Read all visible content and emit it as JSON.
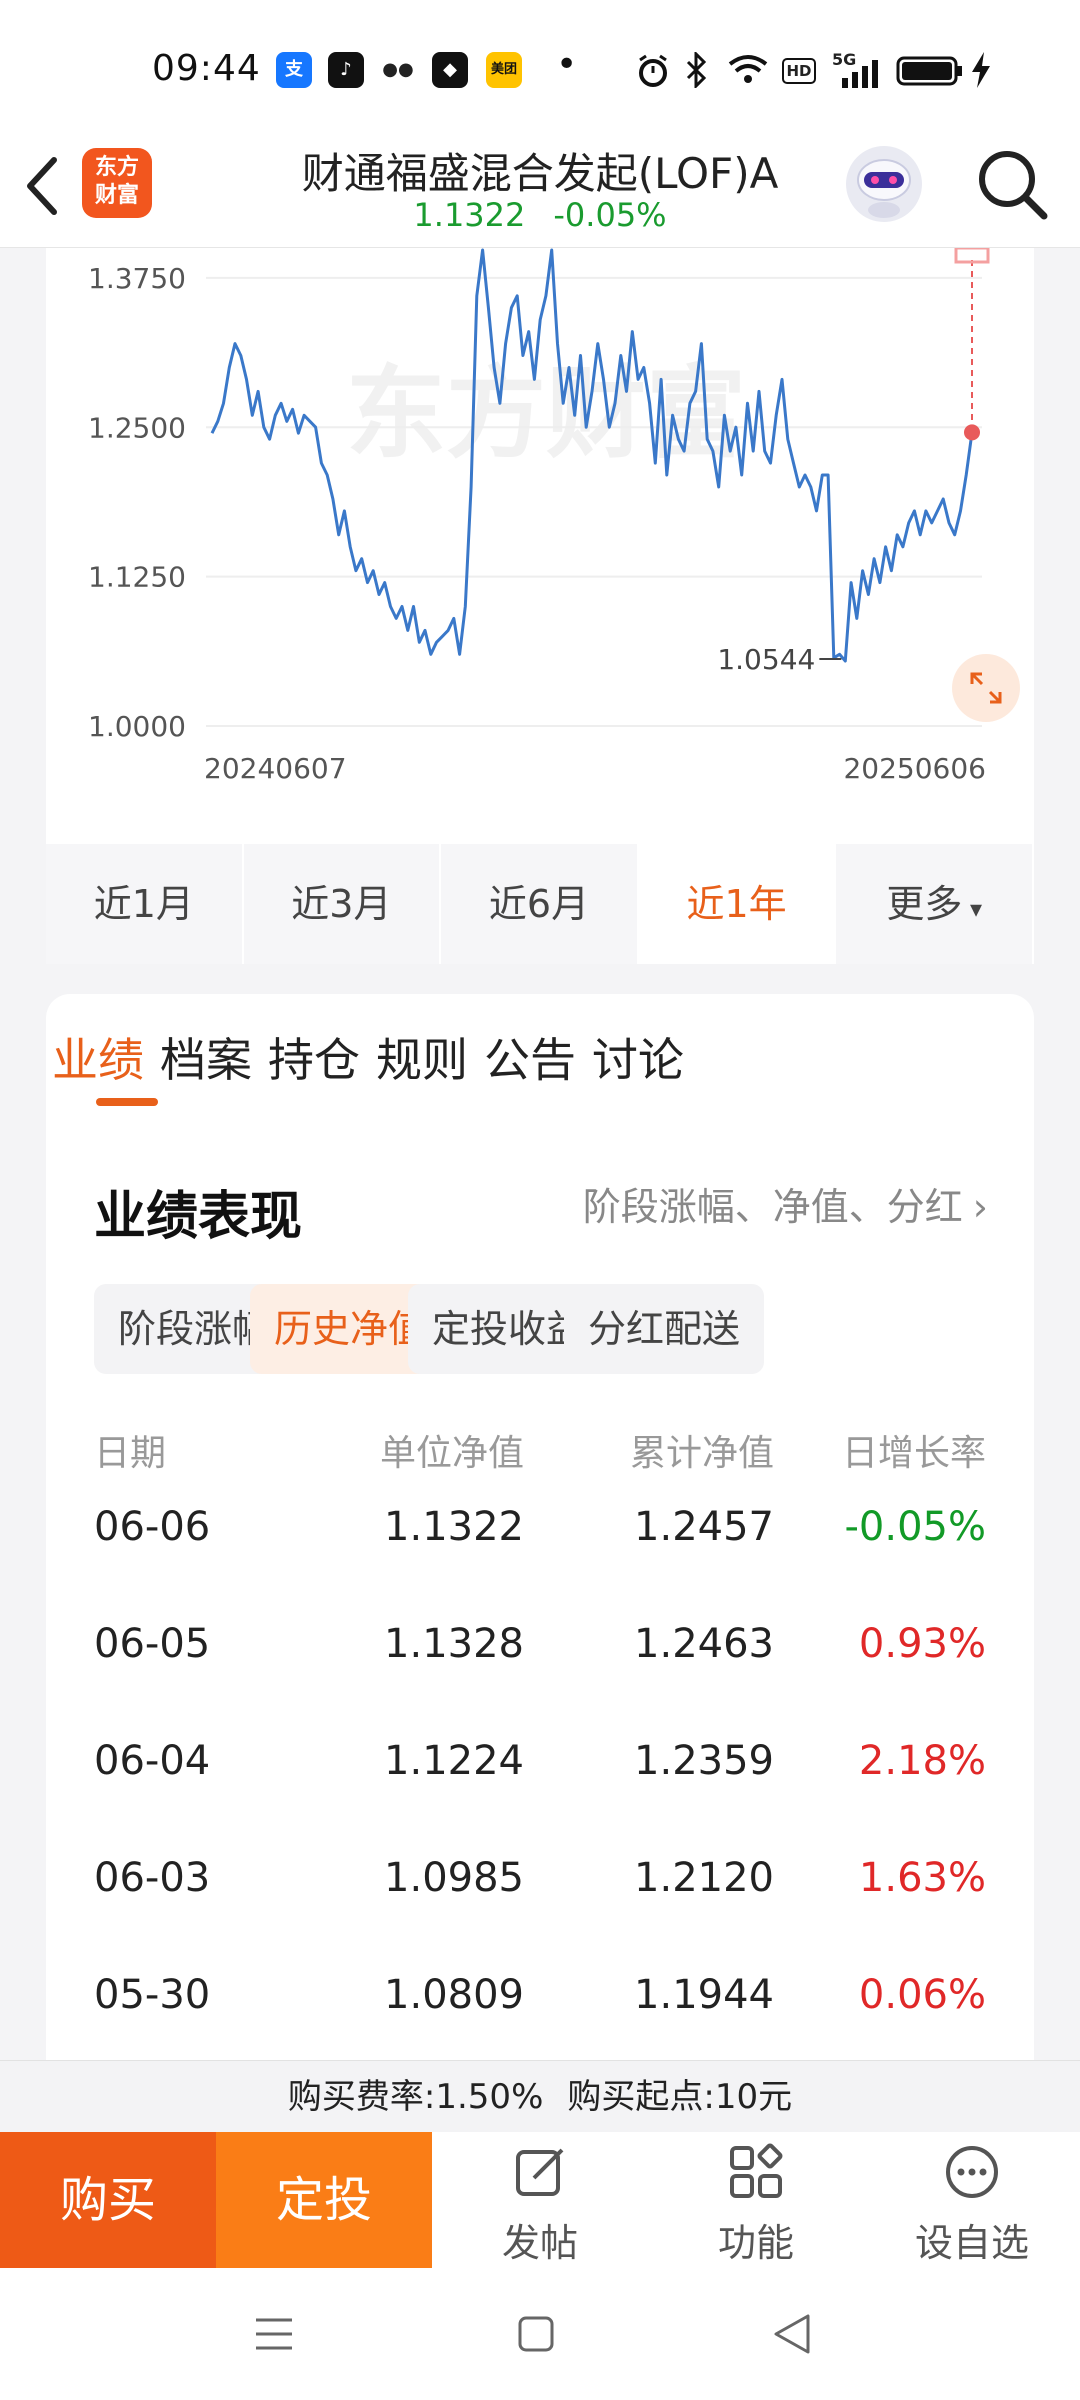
{
  "status": {
    "time": "09:44",
    "apps": [
      {
        "name": "alipay-icon",
        "glyph": "支",
        "color": "#1677ff"
      },
      {
        "name": "douyin-icon",
        "glyph": "♪",
        "color": "#111111"
      },
      {
        "name": "wechat-icon",
        "glyph": "●●",
        "color": "#222222"
      },
      {
        "name": "app-icon",
        "glyph": "◆",
        "color": "#111111"
      },
      {
        "name": "meituan-icon",
        "glyph": "美团",
        "color": "#ffc300"
      }
    ],
    "dot": "•",
    "hd": "HD",
    "net": "5G"
  },
  "header": {
    "logo_line1": "东方",
    "logo_line2": "财富",
    "title": "财通福盛混合发起(LOF)A",
    "nav": "1.1322",
    "change": "-0.05%"
  },
  "chart_data": {
    "type": "line",
    "y_ticks": [
      "1.3750",
      "1.2500",
      "1.1250",
      "1.0000"
    ],
    "ylim": [
      1.0,
      1.4
    ],
    "x_labels": [
      "20240607",
      "20250606"
    ],
    "min_label": "1.0544",
    "watermark": "东方财富",
    "series": [
      {
        "values": [
          1.245,
          1.255,
          1.27,
          1.3,
          1.32,
          1.31,
          1.29,
          1.26,
          1.28,
          1.25,
          1.24,
          1.26,
          1.27,
          1.255,
          1.265,
          1.245,
          1.26,
          1.255,
          1.25,
          1.22,
          1.21,
          1.19,
          1.16,
          1.18,
          1.15,
          1.13,
          1.14,
          1.12,
          1.13,
          1.11,
          1.12,
          1.1,
          1.09,
          1.1,
          1.08,
          1.1,
          1.07,
          1.08,
          1.06,
          1.07,
          1.075,
          1.08,
          1.09,
          1.06,
          1.1,
          1.2,
          1.36,
          1.42,
          1.35,
          1.3,
          1.27,
          1.32,
          1.35,
          1.36,
          1.31,
          1.33,
          1.29,
          1.34,
          1.36,
          1.4,
          1.32,
          1.27,
          1.3,
          1.26,
          1.31,
          1.25,
          1.28,
          1.32,
          1.29,
          1.25,
          1.27,
          1.31,
          1.28,
          1.33,
          1.29,
          1.3,
          1.27,
          1.22,
          1.29,
          1.21,
          1.26,
          1.24,
          1.23,
          1.27,
          1.28,
          1.32,
          1.24,
          1.23,
          1.2,
          1.26,
          1.23,
          1.25,
          1.21,
          1.27,
          1.23,
          1.28,
          1.23,
          1.22,
          1.26,
          1.29,
          1.24,
          1.22,
          1.2,
          1.21,
          1.2,
          1.18,
          1.21,
          1.21,
          1.057,
          1.06,
          1.0544,
          1.12,
          1.09,
          1.13,
          1.11,
          1.14,
          1.12,
          1.15,
          1.13,
          1.16,
          1.15,
          1.17,
          1.18,
          1.16,
          1.18,
          1.17,
          1.18,
          1.19,
          1.17,
          1.16,
          1.18,
          1.21,
          1.2457
        ]
      }
    ],
    "marker_color": "#e85a5a",
    "line_color": "#3a78c9"
  },
  "periods": [
    "近1月",
    "近3月",
    "近6月",
    "近1年",
    "更多"
  ],
  "periods_active": 3,
  "tabs": [
    "业绩",
    "档案",
    "持仓",
    "规则",
    "公告",
    "讨论"
  ],
  "tabs_active": 0,
  "perf": {
    "title": "业绩表现",
    "link": "阶段涨幅、净值、分红",
    "chips": [
      "阶段涨幅",
      "历史净值",
      "定投收益",
      "分红配送"
    ],
    "chips_active": 1,
    "columns": [
      "日期",
      "单位净值",
      "累计净值",
      "日增长率"
    ],
    "rows": [
      {
        "date": "06-06",
        "unit": "1.1322",
        "total": "1.2457",
        "rate": "-0.05%",
        "dir": "down"
      },
      {
        "date": "06-05",
        "unit": "1.1328",
        "total": "1.2463",
        "rate": "0.93%",
        "dir": "up"
      },
      {
        "date": "06-04",
        "unit": "1.1224",
        "total": "1.2359",
        "rate": "2.18%",
        "dir": "up"
      },
      {
        "date": "06-03",
        "unit": "1.0985",
        "total": "1.2120",
        "rate": "1.63%",
        "dir": "up"
      },
      {
        "date": "05-30",
        "unit": "1.0809",
        "total": "1.1944",
        "rate": "0.06%",
        "dir": "up"
      }
    ]
  },
  "fee": {
    "rate": "购买费率:1.50%",
    "min": "购买起点:10元"
  },
  "bottom": {
    "buy": "购买",
    "plan": "定投",
    "items": [
      "发帖",
      "功能",
      "设自选"
    ]
  }
}
